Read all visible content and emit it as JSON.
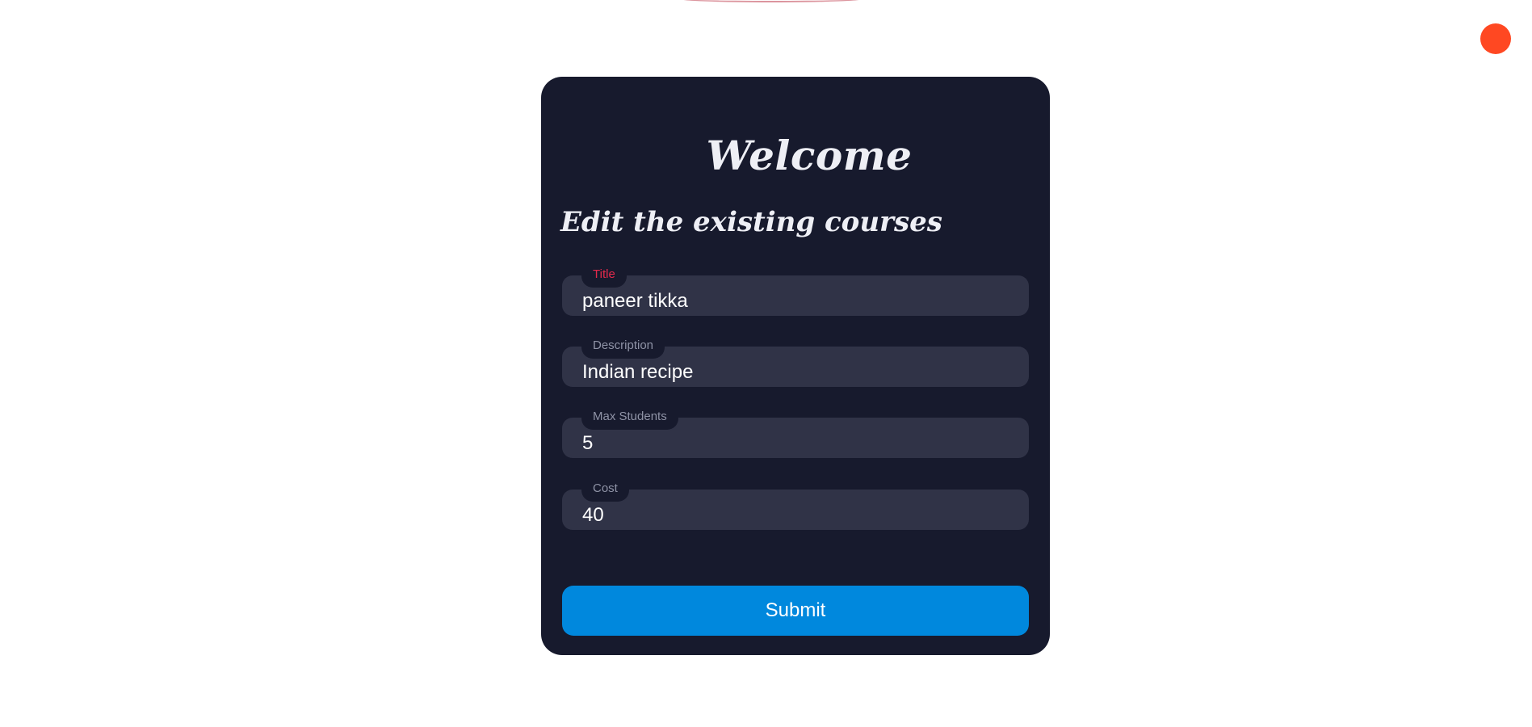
{
  "header": {
    "status_color": "#ff4822"
  },
  "form": {
    "welcome": "Welcome",
    "subtitle": "Edit the existing courses",
    "fields": [
      {
        "label": "Title",
        "value": "paneer tikka",
        "active": true
      },
      {
        "label": "Description",
        "value": "Indian recipe",
        "active": false
      },
      {
        "label": "Max Students",
        "value": "5",
        "active": false
      },
      {
        "label": "Cost",
        "value": "40",
        "active": false
      }
    ],
    "submit_label": "Submit",
    "colors": {
      "card_bg": "#171a2d",
      "input_bg": "#303347",
      "active_label": "#e42a4c",
      "submit_bg": "#0088dd"
    }
  }
}
